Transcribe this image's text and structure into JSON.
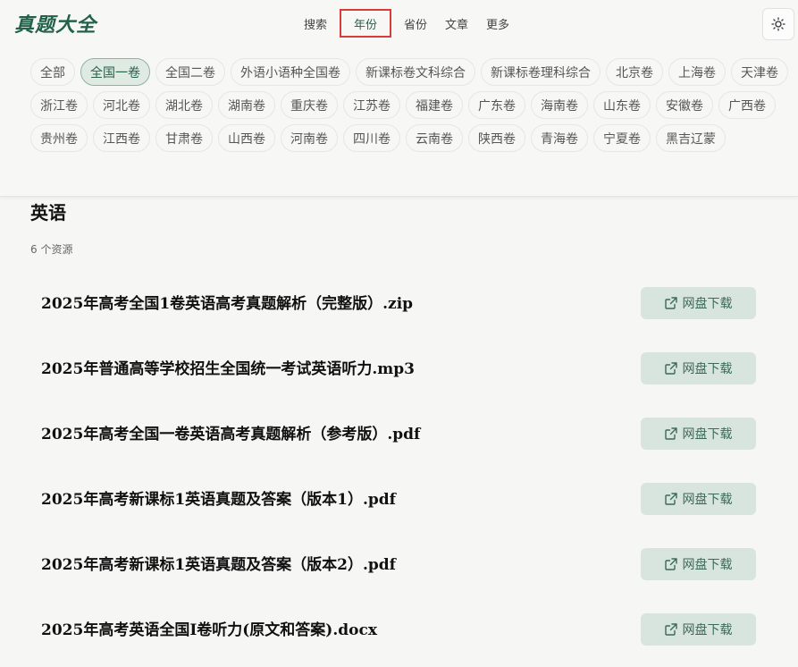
{
  "header": {
    "logo": "真题大全",
    "nav": [
      "搜索",
      "年份",
      "省份",
      "文章",
      "更多"
    ],
    "active_nav": 1
  },
  "tags": [
    "全部",
    "全国一卷",
    "全国二卷",
    "外语小语种全国卷",
    "新课标卷文科综合",
    "新课标卷理科综合",
    "北京卷",
    "上海卷",
    "天津卷",
    "浙江卷",
    "河北卷",
    "湖北卷",
    "湖南卷",
    "重庆卷",
    "江苏卷",
    "福建卷",
    "广东卷",
    "海南卷",
    "山东卷",
    "安徽卷",
    "广西卷",
    "贵州卷",
    "江西卷",
    "甘肃卷",
    "山西卷",
    "河南卷",
    "四川卷",
    "云南卷",
    "陕西卷",
    "青海卷",
    "宁夏卷",
    "黑吉辽蒙"
  ],
  "active_tag": 1,
  "section": {
    "title": "英语",
    "count": "6 个资源"
  },
  "download_label": "网盘下载",
  "resources": [
    "2025年高考全国1卷英语高考真题解析（完整版）.zip",
    "2025年普通高等学校招生全国统一考试英语听力.mp3",
    "2025年高考全国一卷英语高考真题解析（参考版）.pdf",
    "2025年高考新课标1英语真题及答案（版本1）.pdf",
    "2025年高考新课标1英语真题及答案（版本2）.pdf",
    "2025年高考英语全国I卷听力(原文和答案).docx"
  ]
}
